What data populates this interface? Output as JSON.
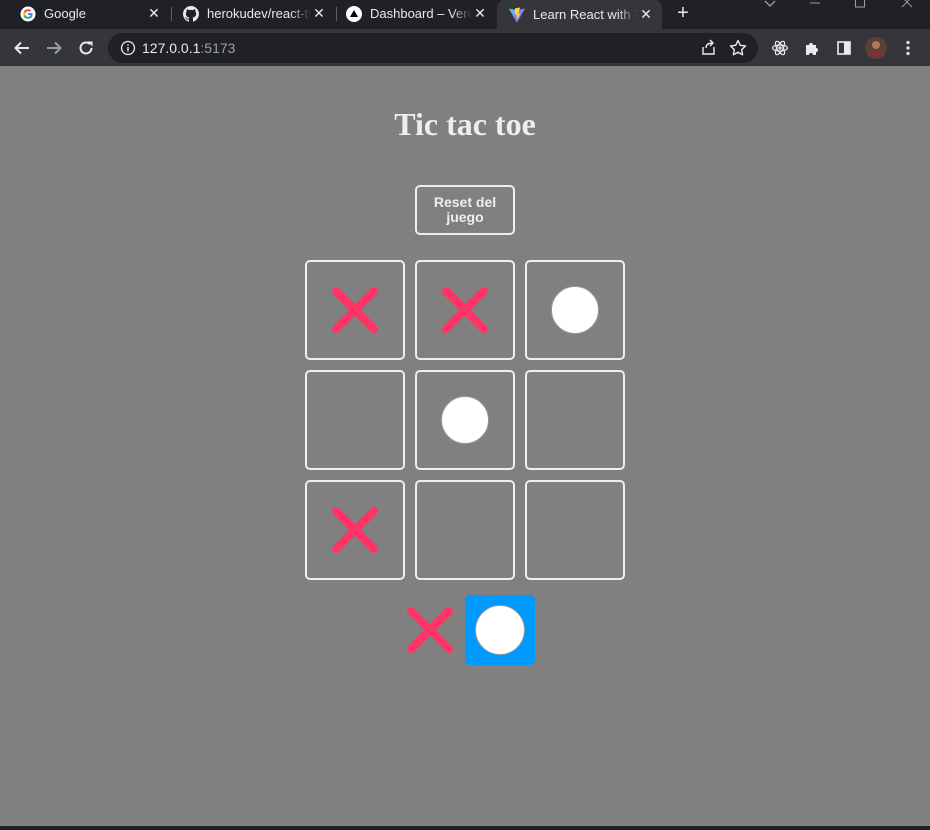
{
  "browser": {
    "tabs": [
      {
        "title": "Google",
        "icon": "google-icon",
        "active": false
      },
      {
        "title": "herokudev/react-tic-tac-toe",
        "icon": "github-icon",
        "active": false
      },
      {
        "title": "Dashboard – Vercel",
        "icon": "vercel-icon",
        "active": false
      },
      {
        "title": "Learn React with TypeScript",
        "icon": "vite-icon",
        "active": true
      }
    ],
    "url_host": "127.0.0.1",
    "url_port": ":5173"
  },
  "game": {
    "title": "Tic tac toe",
    "reset_label": "Reset del juego",
    "board": [
      "X",
      "X",
      "O",
      "",
      "O",
      "",
      "X",
      "",
      ""
    ],
    "turn_options": [
      "X",
      "O"
    ],
    "current_turn": "O",
    "colors": {
      "background": "#808080",
      "x_color": "#ff3366",
      "turn_highlight": "#0099ff",
      "border": "#eeeeee"
    }
  }
}
